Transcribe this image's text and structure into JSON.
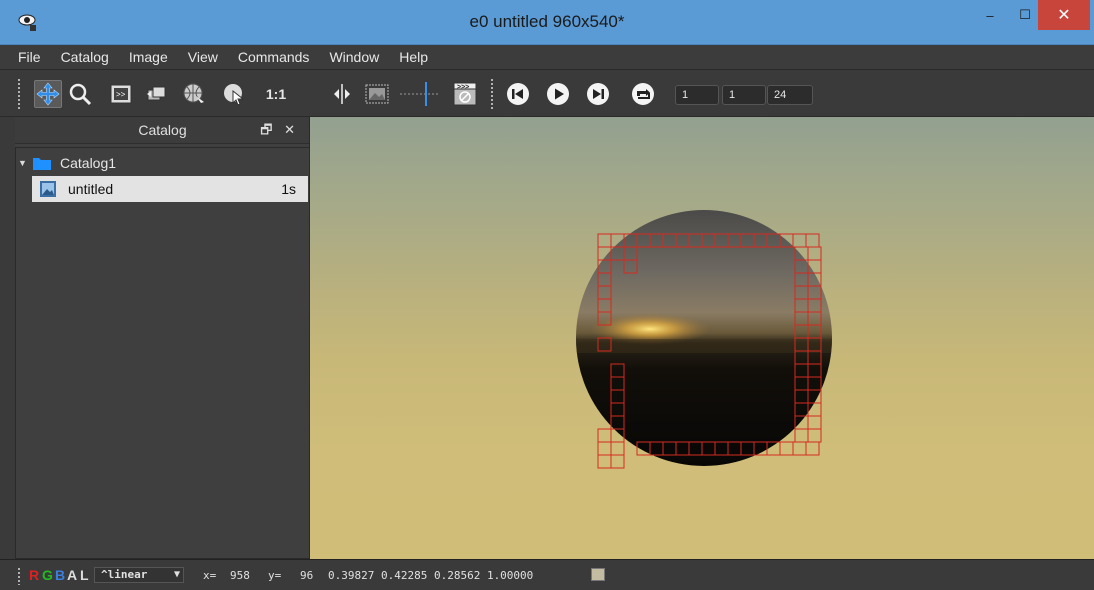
{
  "window": {
    "title": "e0 untitled 960x540*",
    "buttons": {
      "minimize": "–",
      "maximize": "☐",
      "close": "✕"
    }
  },
  "menu": [
    "File",
    "Catalog",
    "Image",
    "View",
    "Commands",
    "Window",
    "Help"
  ],
  "toolbar": {
    "icons": [
      "pan-tool-icon",
      "zoom-icon",
      "filmstrip-icon",
      "layers-icon",
      "globe-icon",
      "cursor-icon",
      "one-to-one-icon",
      "split-icon",
      "picture-icon",
      "timeline-icon",
      "clapper-icon",
      "skip-start-icon",
      "play-icon",
      "skip-end-icon",
      "loop-icon"
    ],
    "ratio_label": "1:1",
    "frame_start": "1",
    "frame_current": "1",
    "frame_rate": "24"
  },
  "catalog": {
    "title": "Catalog",
    "panel_buttons": "🗗 ✕",
    "folder": "Catalog1",
    "item": {
      "label": "untitled",
      "duration": "1s"
    }
  },
  "status": {
    "channels": [
      "R",
      "G",
      "B",
      "A",
      "L"
    ],
    "gamma": "^linear",
    "x_label": "x=",
    "x_value": "958",
    "y_label": "y=",
    "y_value": "96",
    "pixel_values": "0.39827 0.42285 0.28562 1.00000"
  },
  "colors": {
    "titlebar": "#5a9bd6",
    "close": "#c7453a",
    "bucket_outline": "#e02020",
    "channel_r": "#e02020",
    "channel_g": "#22bb22",
    "channel_b": "#3a7ee0"
  }
}
